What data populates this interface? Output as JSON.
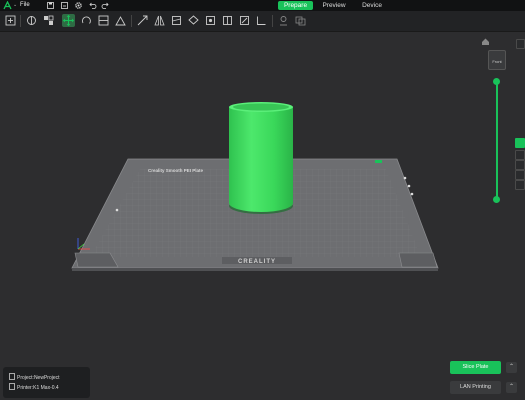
{
  "menu": {
    "file_label": "File"
  },
  "tabs": [
    {
      "label": "Prepare",
      "active": true
    },
    {
      "label": "Preview",
      "active": false
    },
    {
      "label": "Device",
      "active": false
    }
  ],
  "toolbar_icons": [
    "add-object",
    "add-plate",
    "auto-arrange",
    "orient",
    "split",
    "layout",
    "cut",
    "mirror",
    "assemble",
    "support",
    "seam",
    "paint",
    "measure",
    "text",
    "fuzzy-skin",
    "variable-layer",
    "place-face",
    "boolean"
  ],
  "bed": {
    "brand": "CREALITY",
    "plate_label": "Creality Smooth PEI Plate"
  },
  "colors": {
    "accent": "#19c25a",
    "model": "#3ce060",
    "bed": "#6f7073"
  },
  "right_panel": {
    "view_label": "Front"
  },
  "project": {
    "name_label": "Project:NewProject",
    "printer_label": "Printer:K1 Max-0.4"
  },
  "actions": {
    "slice_label": "Slice Plate",
    "lan_label": "LAN Printing"
  }
}
